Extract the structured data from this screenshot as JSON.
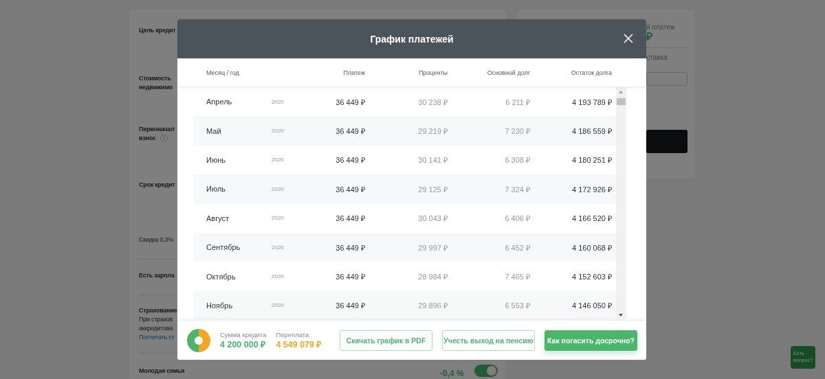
{
  "page": {
    "left_card": {
      "sections": [
        {
          "lines": [
            {
              "kind": "label",
              "text": "Цель кредит"
            }
          ]
        },
        {
          "lines": [
            {
              "kind": "label",
              "text": "Стоимость"
            },
            {
              "kind": "label",
              "text": "недвижимо"
            }
          ]
        },
        {
          "lines": [
            {
              "kind": "label",
              "text": "Первоначал"
            },
            {
              "kind": "label",
              "text": "взнос",
              "info": true
            }
          ]
        },
        {
          "lines": [
            {
              "kind": "label",
              "text": "Срок кредит"
            }
          ]
        },
        {
          "lines": [
            {
              "kind": "text",
              "text": "Скидка 0,3%"
            }
          ]
        },
        {
          "lines": [
            {
              "kind": "label",
              "text": "Есть зарпла"
            }
          ]
        },
        {
          "lines": [
            {
              "kind": "label",
              "text": "Страхование"
            },
            {
              "kind": "text",
              "text": "При страхов"
            },
            {
              "kind": "text",
              "text": "аккредитова"
            },
            {
              "kind": "link",
              "text": "Посчитать ст"
            }
          ]
        },
        {
          "lines": [
            {
              "kind": "label",
              "text": "Молодая семья"
            }
          ],
          "discount": "-0,4 %",
          "toggle": {
            "on": true
          }
        }
      ]
    },
    "right_card": {
      "payment_label": "й платеж",
      "payment_value": "₽",
      "rate_label": "ставка"
    },
    "chat": {
      "label": "Есть вопрос?"
    }
  },
  "modal": {
    "title": "График платежей",
    "columns": [
      "Месяц / год",
      "Платеж",
      "Проценты",
      "Основной долг",
      "Остаток долга"
    ],
    "rows": [
      {
        "month": "Апрель",
        "year": "2020",
        "payment": "36 449 ₽",
        "interest": "30 238 ₽",
        "principal": "6 211 ₽",
        "balance": "4 193 789 ₽"
      },
      {
        "month": "Май",
        "year": "2020",
        "payment": "36 449 ₽",
        "interest": "29 219 ₽",
        "principal": "7 230 ₽",
        "balance": "4 186 559 ₽"
      },
      {
        "month": "Июнь",
        "year": "2020",
        "payment": "36 449 ₽",
        "interest": "30 141 ₽",
        "principal": "6 308 ₽",
        "balance": "4 180 251 ₽"
      },
      {
        "month": "Июль",
        "year": "2020",
        "payment": "36 449 ₽",
        "interest": "29 125 ₽",
        "principal": "7 324 ₽",
        "balance": "4 172 926 ₽"
      },
      {
        "month": "Август",
        "year": "2020",
        "payment": "36 449 ₽",
        "interest": "30 043 ₽",
        "principal": "6 406 ₽",
        "balance": "4 166 520 ₽"
      },
      {
        "month": "Сентябрь",
        "year": "2020",
        "payment": "36 449 ₽",
        "interest": "29 997 ₽",
        "principal": "6 452 ₽",
        "balance": "4 160 068 ₽"
      },
      {
        "month": "Октябрь",
        "year": "2020",
        "payment": "36 449 ₽",
        "interest": "28 984 ₽",
        "principal": "7 465 ₽",
        "balance": "4 152 603 ₽"
      },
      {
        "month": "Ноябрь",
        "year": "2020",
        "payment": "36 449 ₽",
        "interest": "29 896 ₽",
        "principal": "6 553 ₽",
        "balance": "4 146 050 ₽"
      }
    ],
    "summary": [
      {
        "label": "Сумма кредита",
        "value": "4 200 000 ₽",
        "color": "#4cb56c"
      },
      {
        "label": "Переплата",
        "value": "4 549 079 ₽",
        "color": "#f5a623"
      }
    ],
    "buttons": [
      {
        "label": "Скачать график в PDF",
        "kind": "outline"
      },
      {
        "label": "Учесть выход на пенсию",
        "kind": "outline"
      },
      {
        "label": "Как погасить досрочно?",
        "kind": "primary"
      }
    ]
  }
}
